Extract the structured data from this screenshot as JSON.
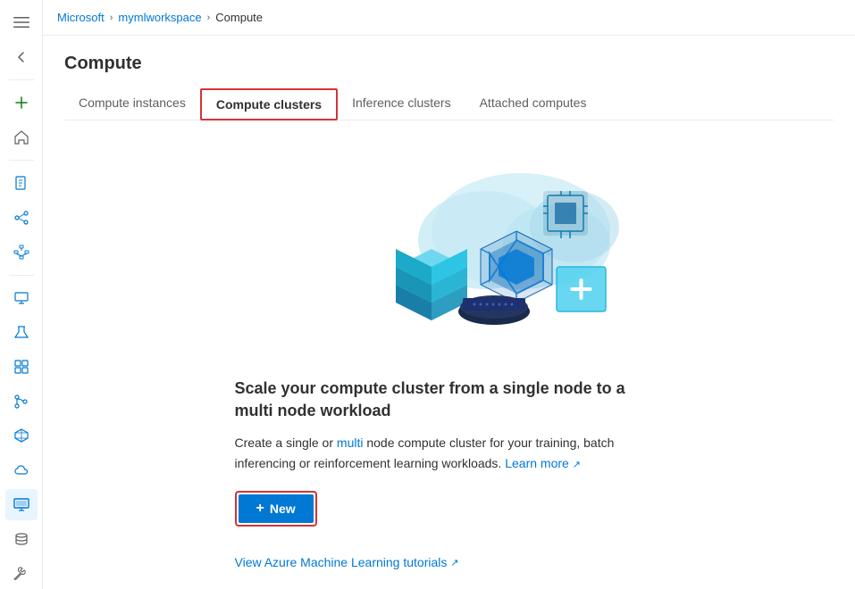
{
  "breadcrumb": {
    "items": [
      "Microsoft",
      "mymlworkspace",
      "Compute"
    ],
    "separators": [
      "›",
      "›"
    ]
  },
  "page": {
    "title": "Compute"
  },
  "tabs": [
    {
      "id": "compute-instances",
      "label": "Compute instances",
      "active": false
    },
    {
      "id": "compute-clusters",
      "label": "Compute clusters",
      "active": true
    },
    {
      "id": "inference-clusters",
      "label": "Inference clusters",
      "active": false
    },
    {
      "id": "attached-computes",
      "label": "Attached computes",
      "active": false
    }
  ],
  "content": {
    "headline": "Scale your compute cluster from a single node to a multi node workload",
    "description_before": "Create a single or ",
    "description_link1": "multi",
    "description_middle": " node compute cluster for your training, batch inferencing or reinforcement learning workloads. ",
    "description_link2": "Learn more",
    "description_external": "↗",
    "new_button_label": "New",
    "new_button_plus": "+",
    "tutorial_link_label": "View Azure Machine Learning tutorials",
    "tutorial_link_external": "↗"
  },
  "sidebar": {
    "icons": [
      {
        "id": "menu",
        "symbol": "☰",
        "active": false
      },
      {
        "id": "back",
        "symbol": "↩",
        "active": false
      },
      {
        "id": "add",
        "symbol": "+",
        "active": false,
        "green": true
      },
      {
        "id": "home",
        "symbol": "⌂",
        "active": false
      },
      {
        "id": "documents",
        "symbol": "📄",
        "active": false
      },
      {
        "id": "pipeline",
        "symbol": "⚡",
        "active": false
      },
      {
        "id": "hierarchy",
        "symbol": "⊞",
        "active": false
      },
      {
        "id": "monitor",
        "symbol": "📺",
        "active": false
      },
      {
        "id": "flask",
        "symbol": "🧪",
        "active": false
      },
      {
        "id": "grid",
        "symbol": "⊟",
        "active": false
      },
      {
        "id": "branch",
        "symbol": "⑂",
        "active": false
      },
      {
        "id": "stack",
        "symbol": "⬡",
        "active": false
      },
      {
        "id": "cloud",
        "symbol": "☁",
        "active": false
      },
      {
        "id": "compute-active",
        "symbol": "🖥",
        "active": true
      },
      {
        "id": "database",
        "symbol": "🗄",
        "active": false
      },
      {
        "id": "tool",
        "symbol": "🔧",
        "active": false
      }
    ]
  }
}
